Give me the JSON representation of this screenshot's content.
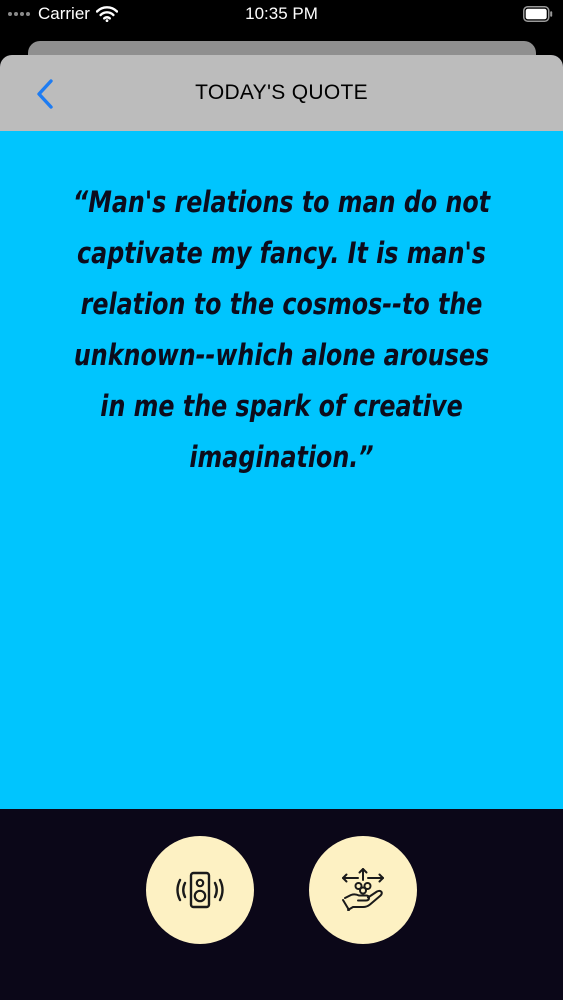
{
  "status_bar": {
    "carrier": "Carrier",
    "time": "10:35 PM"
  },
  "nav": {
    "title": "TODAY'S QUOTE",
    "back_icon": "chevron-left-icon"
  },
  "quote": {
    "text": "“Man's relations to man do not captivate my fancy. It is man's relation to the cosmos--to the unknown--which alone arouses in me the spark of creative imagination.”"
  },
  "actions": [
    {
      "icon": "speaker-icon"
    },
    {
      "icon": "hand-share-icon"
    }
  ],
  "colors": {
    "quote_background": "#00c5fe",
    "nav_background": "#bcbcbc",
    "bottom_background": "#0b0718",
    "button_background": "#fdf1c3",
    "back_chevron": "#1e7cf2",
    "quote_text": "#0c0c1c"
  }
}
